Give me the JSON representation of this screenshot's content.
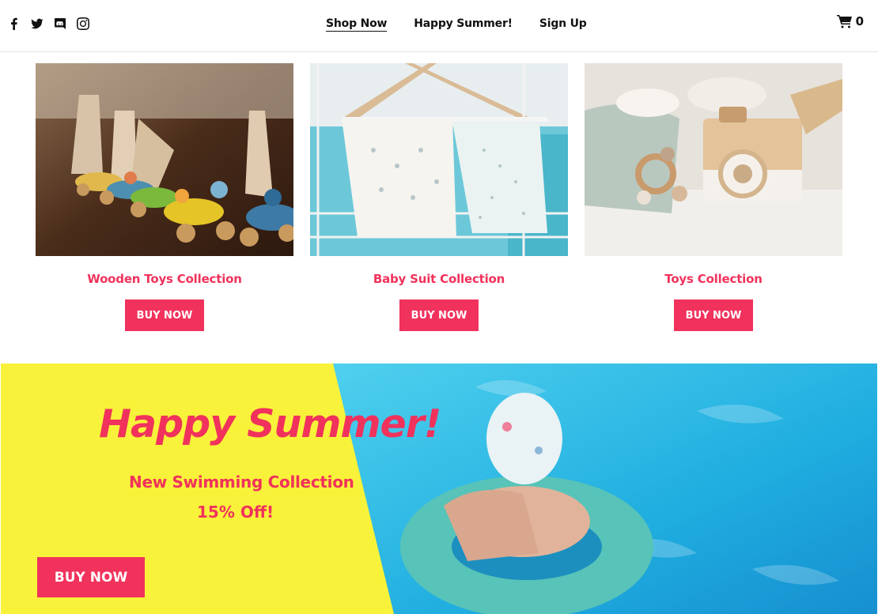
{
  "header": {
    "social": [
      "facebook-icon",
      "twitter-icon",
      "discord-icon",
      "instagram-icon"
    ],
    "nav": [
      {
        "label": "Shop Now"
      },
      {
        "label": "Happy Summer!"
      },
      {
        "label": "Sign Up"
      }
    ],
    "cart_count": "0"
  },
  "products": [
    {
      "title": "Wooden Toys Collection",
      "button": "BUY NOW"
    },
    {
      "title": "Baby Suit Collection",
      "button": "BUY NOW"
    },
    {
      "title": "Toys Collection",
      "button": "BUY NOW"
    }
  ],
  "banner": {
    "heading": "Happy Summer!",
    "subheading": "New Swimming Collection",
    "discount": "15% Off!",
    "button": "BUY NOW"
  },
  "colors": {
    "accent": "#f0325c",
    "banner_bg": "#f9f23a",
    "pool": "#22b4e6"
  }
}
